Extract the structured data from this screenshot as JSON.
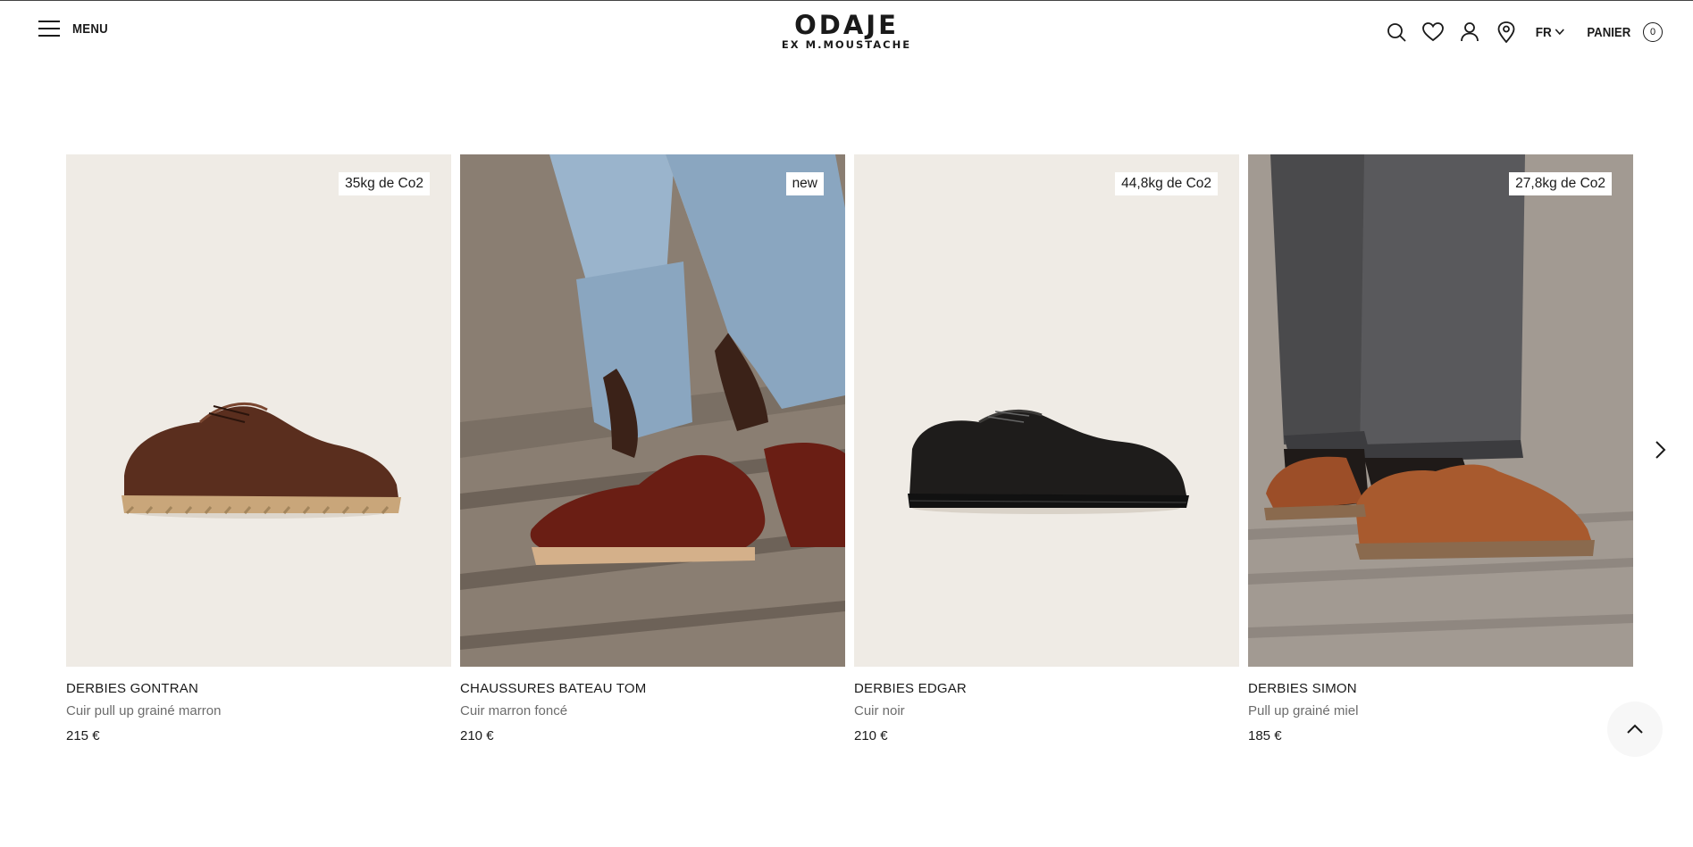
{
  "header": {
    "menu_label": "MENU",
    "logo_main": "ODAJE",
    "logo_sub": "EX M.MOUSTACHE",
    "icons": [
      "search-icon",
      "heart-icon",
      "user-icon",
      "location-pin-icon"
    ],
    "language": "FR",
    "cart_label": "PANIER",
    "cart_count": "0"
  },
  "products": [
    {
      "badge": "35kg de Co2",
      "name": "DERBIES GONTRAN",
      "description": "Cuir pull up grainé marron",
      "price": "215 €",
      "image": "brown-grained-moccasin-derby-on-cream-background"
    },
    {
      "badge": "new",
      "name": "CHAUSSURES BATEAU TOM",
      "description": "Cuir marron foncé",
      "price": "210 €",
      "image": "burgundy-boat-shoe-worn-on-wooden-deck"
    },
    {
      "badge": "44,8kg de Co2",
      "name": "DERBIES EDGAR",
      "description": "Cuir noir",
      "price": "210 €",
      "image": "black-leather-derby-on-cream-background"
    },
    {
      "badge": "27,8kg de Co2",
      "name": "DERBIES SIMON",
      "description": "Pull up grainé miel",
      "price": "185 €",
      "image": "honey-leather-derby-worn-on-wooden-boardwalk"
    }
  ],
  "controls": {
    "next_icon": "chevron-right-icon",
    "scroll_top_icon": "chevron-up-icon"
  },
  "colors": {
    "text": "#1a1a1a",
    "muted_text": "#6c6c6c",
    "product_background": "#efebe5"
  }
}
